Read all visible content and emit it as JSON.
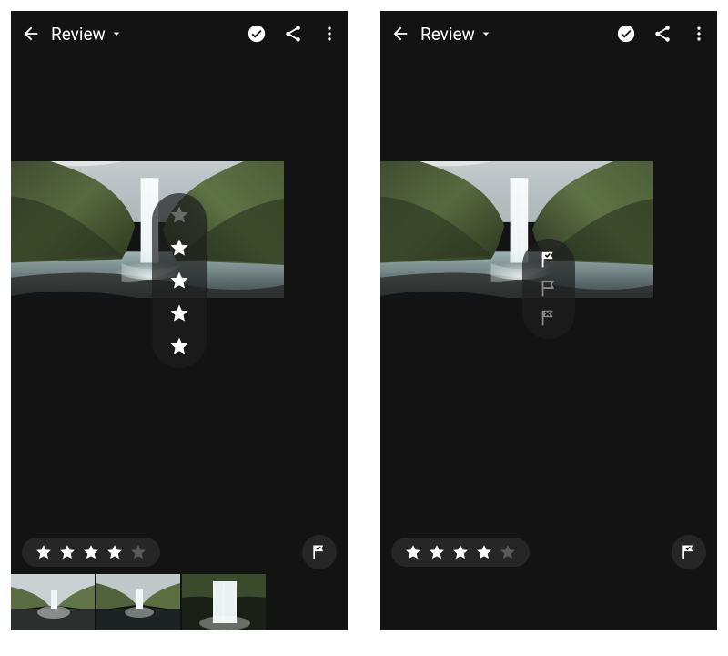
{
  "left": {
    "header": {
      "title": "Review"
    },
    "overlay_stars": {
      "count": 5,
      "filled": 4
    },
    "bottom_rating": {
      "count": 5,
      "filled": 4
    },
    "thumbs": 3
  },
  "right": {
    "header": {
      "title": "Review"
    },
    "overlay_flags": [
      "pick",
      "unflag",
      "reject"
    ],
    "bottom_rating": {
      "count": 5,
      "filled": 4
    },
    "thumbs": 0
  },
  "colors": {
    "bg": "#131313",
    "pill": "#262626",
    "star_on": "#ffffff",
    "star_off": "#6a6a6a"
  }
}
